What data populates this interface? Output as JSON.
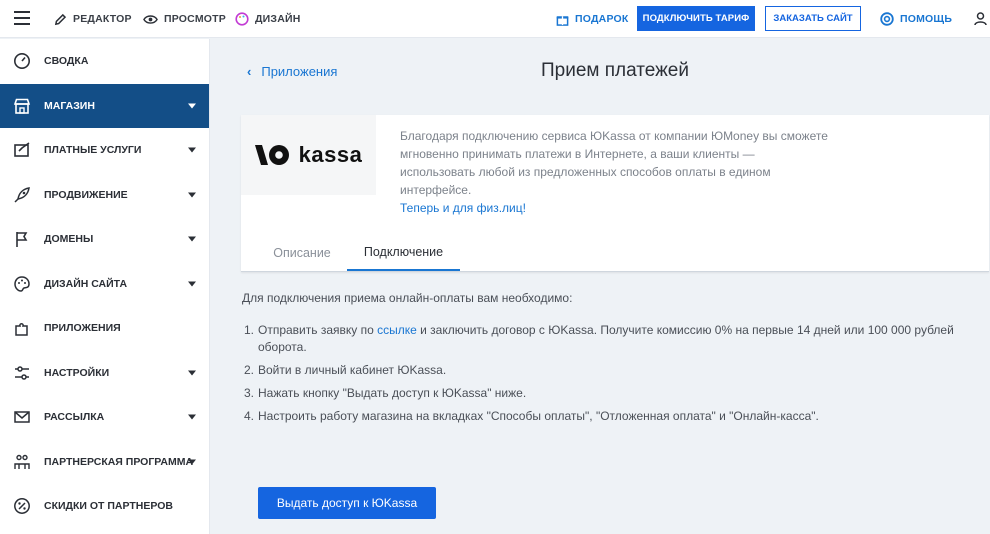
{
  "topbar": {
    "editor": "РЕДАКТОР",
    "preview": "ПРОСМОТР",
    "design": "ДИЗАЙН",
    "gift": "ПОДАРОК",
    "connect_plan": "ПОДКЛЮЧИТЬ ТАРИФ",
    "order_site": "ЗАКАЗАТЬ САЙТ",
    "help": "ПОМОЩЬ"
  },
  "sidebar": {
    "items": [
      {
        "label": "СВОДКА",
        "icon": "gauge-icon",
        "has_caret": false,
        "active": false
      },
      {
        "label": "МАГАЗИН",
        "icon": "store-icon",
        "has_caret": true,
        "active": true
      },
      {
        "label": "ПЛАТНЫЕ УСЛУГИ",
        "icon": "paid-services-icon",
        "has_caret": true,
        "active": false
      },
      {
        "label": "ПРОДВИЖЕНИЕ",
        "icon": "rocket-icon",
        "has_caret": true,
        "active": false
      },
      {
        "label": "ДОМЕНЫ",
        "icon": "flag-icon",
        "has_caret": true,
        "active": false
      },
      {
        "label": "ДИЗАЙН САЙТА",
        "icon": "palette-icon",
        "has_caret": true,
        "active": false
      },
      {
        "label": "ПРИЛОЖЕНИЯ",
        "icon": "puzzle-icon",
        "has_caret": false,
        "active": false
      },
      {
        "label": "НАСТРОЙКИ",
        "icon": "sliders-icon",
        "has_caret": true,
        "active": false
      },
      {
        "label": "РАССЫЛКА",
        "icon": "envelope-icon",
        "has_caret": true,
        "active": false
      },
      {
        "label": "ПАРТНЕРСКАЯ ПРОГРАММА",
        "icon": "partners-icon",
        "has_caret": true,
        "active": false
      },
      {
        "label": "СКИДКИ ОТ ПАРТНЕРОВ",
        "icon": "percent-icon",
        "has_caret": false,
        "active": false
      }
    ]
  },
  "main": {
    "back_label": "Приложения",
    "title": "Прием платежей",
    "logo_text": "kassa",
    "description": "Благодаря подключению сервиса ЮKassa от компании ЮMoney вы сможете мгновенно принимать платежи в Интернете, а ваши клиенты — использовать любой из предложенных способов оплаты в едином интерфейсе.",
    "description_link": "Теперь и для физ.лиц!",
    "tabs": [
      "Описание",
      "Подключение"
    ],
    "intro": "Для подключения приема онлайн-оплаты вам необходимо:",
    "step1_num": "1.",
    "step1_before": "Отправить заявку по ",
    "step1_link": "ссылке",
    "step1_after": " и заключить договор с ЮKassa. Получите комиссию 0% на первые 14 дней или 100 000 рублей оборота.",
    "step2_num": "2.",
    "step2": "Войти в личный кабинет ЮKassa.",
    "step3_num": "3.",
    "step3": "Нажать кнопку \"Выдать доступ к ЮKassa\" ниже.",
    "step4_num": "4.",
    "step4": "Настроить работу магазина на вкладках \"Способы оплаты\", \"Отложенная оплата\" и \"Онлайн-касса\".",
    "grant_button": "Выдать доступ к ЮKassa"
  },
  "colors": {
    "accent": "#1565e0",
    "sidebar_active": "#134e87",
    "link": "#1976d2"
  }
}
